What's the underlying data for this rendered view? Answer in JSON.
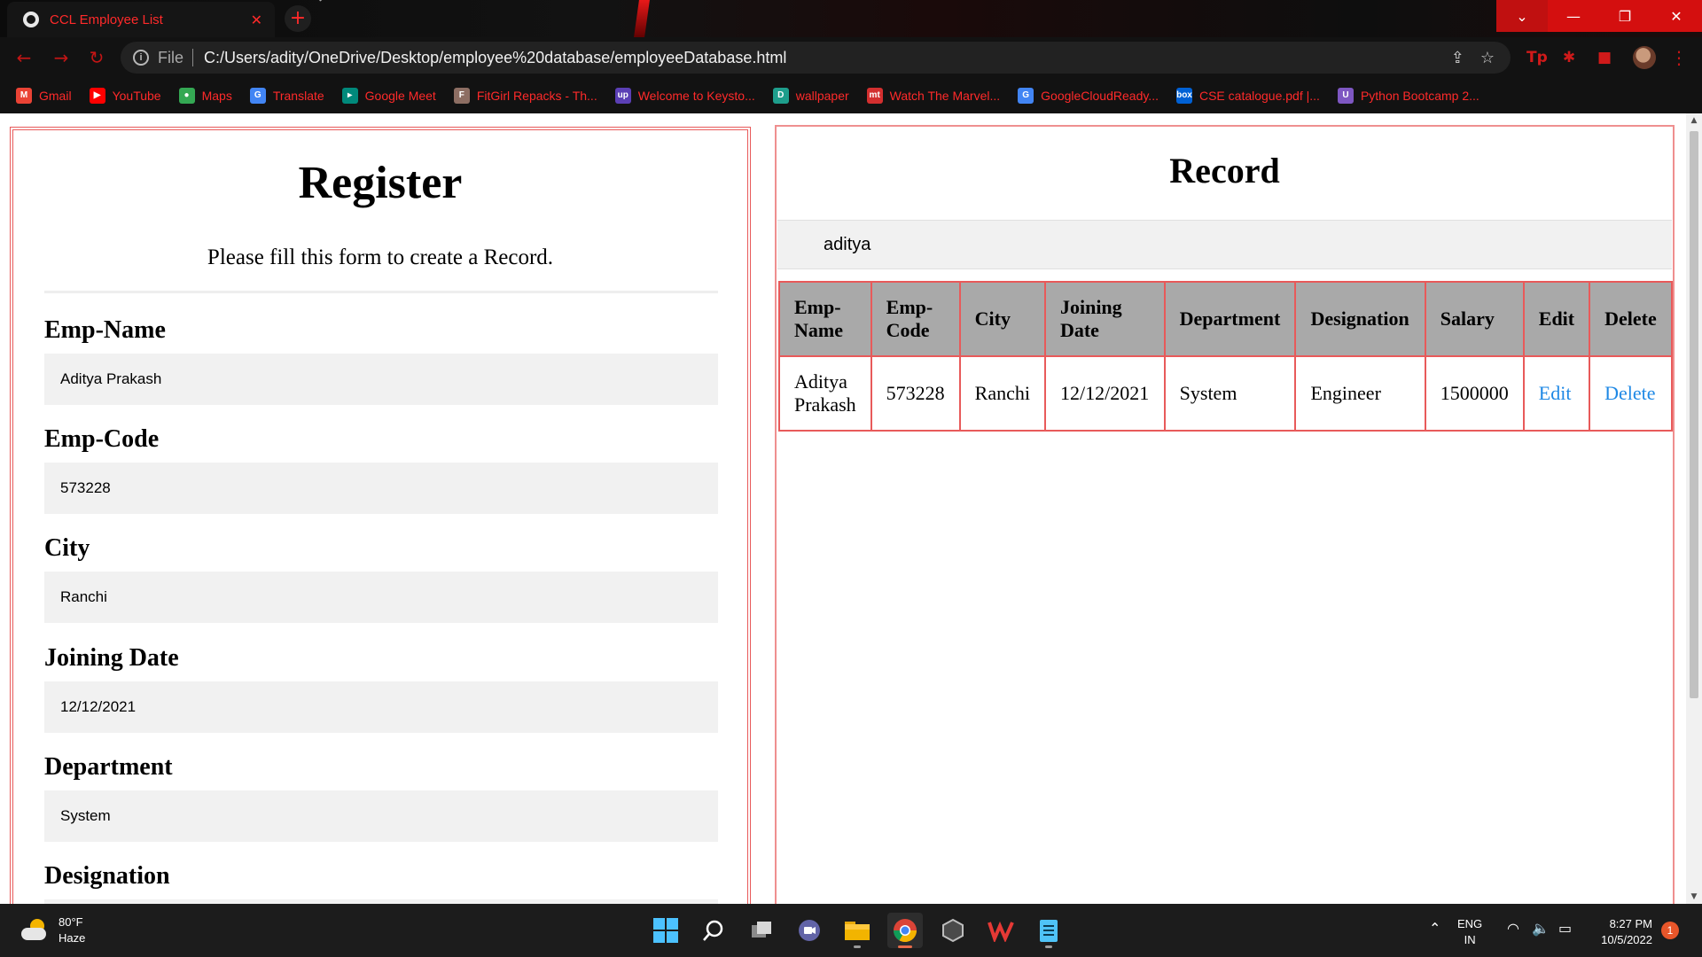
{
  "browser": {
    "tab_title": "CCL Employee List",
    "tab_close": "✕",
    "new_tab": "+",
    "window_controls": {
      "dropdown": "⌄",
      "minimize": "—",
      "restore": "❐",
      "close": "✕"
    },
    "nav": {
      "back": "←",
      "forward": "→",
      "reload": "↻"
    },
    "address": {
      "scheme": "File",
      "url": "C:/Users/adity/OneDrive/Desktop/employee%20database/employeeDatabase.html"
    },
    "bookmarks": [
      {
        "label": "Gmail",
        "icon": "M",
        "color": "#ea4335"
      },
      {
        "label": "YouTube",
        "icon": "▶",
        "color": "#ff0000"
      },
      {
        "label": "Maps",
        "icon": "●",
        "color": "#34a853"
      },
      {
        "label": "Translate",
        "icon": "G",
        "color": "#4285f4"
      },
      {
        "label": "Google Meet",
        "icon": "▸",
        "color": "#00897b"
      },
      {
        "label": "FitGirl Repacks - Th...",
        "icon": "F",
        "color": "#8d6e63"
      },
      {
        "label": "Welcome to Keysto...",
        "icon": "up",
        "color": "#5b3fb5"
      },
      {
        "label": "wallpaper",
        "icon": "D",
        "color": "#1e9e8c"
      },
      {
        "label": "Watch The Marvel...",
        "icon": "mt",
        "color": "#d32f2f"
      },
      {
        "label": "GoogleCloudReady...",
        "icon": "G",
        "color": "#4285f4"
      },
      {
        "label": "CSE catalogue.pdf |...",
        "icon": "box",
        "color": "#0061d5"
      },
      {
        "label": "Python Bootcamp 2...",
        "icon": "U",
        "color": "#7e57c2"
      }
    ]
  },
  "register": {
    "title": "Register",
    "subtitle": "Please fill this form to create a Record.",
    "fields": [
      {
        "label": "Emp-Name",
        "value": "Aditya Prakash"
      },
      {
        "label": "Emp-Code",
        "value": "573228"
      },
      {
        "label": "City",
        "value": "Ranchi"
      },
      {
        "label": "Joining Date",
        "value": "12/12/2021"
      },
      {
        "label": "Department",
        "value": "System"
      },
      {
        "label": "Designation",
        "value": ""
      }
    ]
  },
  "record": {
    "title": "Record",
    "search_value": "aditya",
    "columns": [
      "Emp-Name",
      "Emp-Code",
      "City",
      "Joining Date",
      "Department",
      "Designation",
      "Salary",
      "Edit",
      "Delete"
    ],
    "rows": [
      [
        "Aditya Prakash",
        "573228",
        "Ranchi",
        "12/12/2021",
        "System",
        "Engineer",
        "1500000",
        "Edit",
        "Delete"
      ]
    ]
  },
  "taskbar": {
    "weather": {
      "temp": "80°F",
      "condition": "Haze"
    },
    "apps": [
      "start-icon",
      "search-icon",
      "task-view-icon",
      "teams-icon",
      "file-explorer-icon",
      "chrome-icon",
      "app-icon",
      "wps-office-icon",
      "notepad-icon"
    ],
    "language": {
      "lang": "ENG",
      "region": "IN"
    },
    "time": "8:27 PM",
    "date": "10/5/2022",
    "notifications": "1"
  }
}
